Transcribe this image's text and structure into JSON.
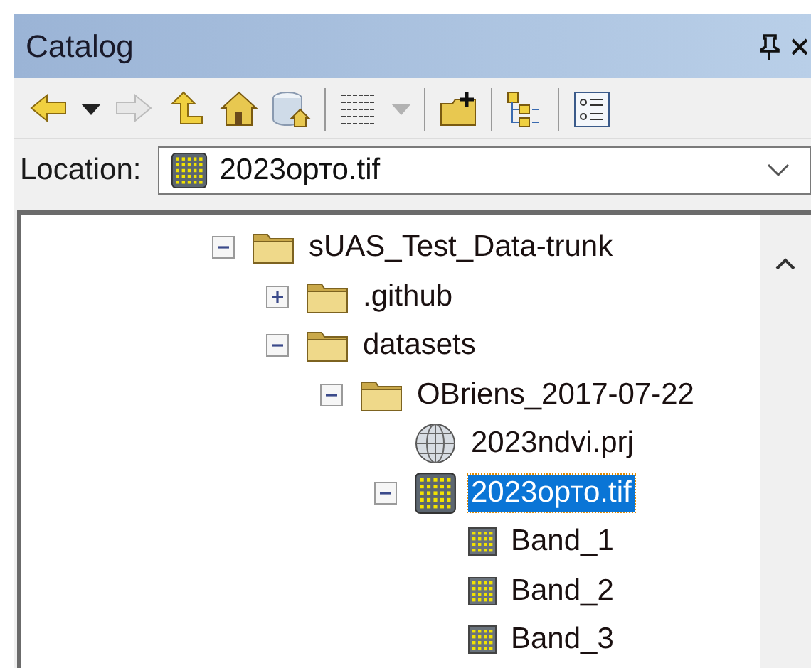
{
  "panel": {
    "title": "Catalog"
  },
  "toolbar": [
    {
      "kind": "back",
      "disabled": false
    },
    {
      "kind": "caret",
      "disabled": false
    },
    {
      "kind": "forward",
      "disabled": true
    },
    {
      "kind": "up",
      "disabled": false
    },
    {
      "kind": "home",
      "disabled": false
    },
    {
      "kind": "database-home",
      "disabled": false
    },
    {
      "kind": "separator"
    },
    {
      "kind": "grid",
      "disabled": false
    },
    {
      "kind": "caret",
      "disabled": true
    },
    {
      "kind": "separator"
    },
    {
      "kind": "connect-folder",
      "disabled": false
    },
    {
      "kind": "separator"
    },
    {
      "kind": "tree-toggle",
      "disabled": false
    },
    {
      "kind": "separator"
    },
    {
      "kind": "details",
      "disabled": false
    }
  ],
  "location": {
    "label": "Location:",
    "value": "2023орто.tif",
    "kind": "raster"
  },
  "tree": [
    {
      "label": "sUAS_Test_Data-trunk",
      "kind": "folder",
      "expanded": true,
      "selected": false,
      "children": [
        {
          "label": ".github",
          "kind": "folder",
          "expanded": false,
          "selected": false
        },
        {
          "label": "datasets",
          "kind": "folder",
          "expanded": true,
          "selected": false,
          "children": [
            {
              "label": "OBriens_2017-07-22",
              "kind": "folder",
              "expanded": true,
              "selected": false,
              "children": [
                {
                  "label": "2023ndvi.prj",
                  "kind": "projection",
                  "selected": false
                },
                {
                  "label": "2023орто.tif",
                  "kind": "raster",
                  "expanded": true,
                  "selected": true,
                  "children": [
                    {
                      "label": "Band_1",
                      "kind": "band",
                      "selected": false
                    },
                    {
                      "label": "Band_2",
                      "kind": "band",
                      "selected": false
                    },
                    {
                      "label": "Band_3",
                      "kind": "band",
                      "selected": false
                    }
                  ]
                }
              ]
            }
          ]
        }
      ]
    }
  ]
}
